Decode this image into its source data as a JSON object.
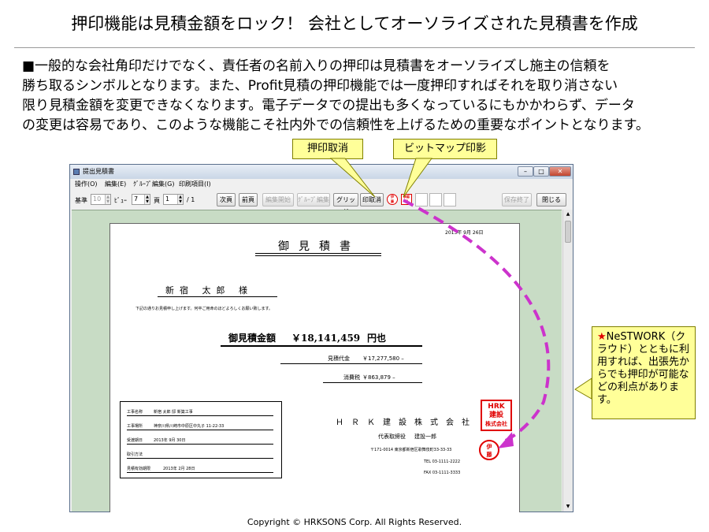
{
  "slide": {
    "title": "押印機能は見積金額をロック！ 会社としてオーソライズされた見積書を作成",
    "description": [
      "■一般的な会社角印だけでなく、責任者の名前入りの押印は見積書をオーソライズし施主の信頼を",
      "勝ち取るシンボルとなります。また、Profit見積の押印機能では一度押印すればそれを取り消さない",
      "限り見積金額を変更できなくなります。電子データでの提出も多くなっているにもかかわらず、データ",
      "の変更は容易であり、このような機能こそ社内外での信頼性を上げるための重要なポイントとなります。"
    ],
    "callouts": {
      "cancel": "押印取消",
      "bitmap": "ビットマップ印影",
      "cloud_star": "★",
      "cloud_brand": "NeSTWORK",
      "cloud_text": "（クラウド）とともに利用すれば、出張先からでも押印が可能などの利点があります。"
    },
    "footer": "Copyright ©  HRKSONS Corp.   All Rights Reserved."
  },
  "window": {
    "title": "提出見積書",
    "controls": {
      "minimize": "–",
      "maximize": "□",
      "close": "✕"
    },
    "menu": [
      "操作(O)",
      "編集(E)",
      "ｸﾞﾙｰﾌﾟ編集(G)",
      "印刷項目(I)"
    ],
    "toolbar": {
      "base_label": "基準",
      "base_value": "10",
      "view_label": "ﾋﾞｭｰ",
      "view_value": "7",
      "page_label": "頁",
      "page_value": "1",
      "page_total": "/ 1",
      "next_page": "次頁",
      "prev_page": "前頁",
      "edit_start": "編集開始",
      "group_edit": "ｸﾞﾙｰﾌﾟ編集",
      "grid": "グリッド",
      "cancel_stamp": "印取消",
      "save_exit": "保存終了",
      "close": "閉じる",
      "seal1_line1": "伊",
      "seal1_line2": "藤",
      "seal2_line1": "承認",
      "seal2_line2": "印"
    },
    "scroll": {
      "up": "▲",
      "down": "▼"
    }
  },
  "document": {
    "date": "2013年 9月 26日",
    "title": "御見積書",
    "customer": "新宿 太郎   様",
    "greeting": "下記の通りお見積申し上げます。何卒ご用命のほどよろしくお願い致します。",
    "total_label": "御見積金額",
    "total_value": "￥18,141,459",
    "total_unit": "円也",
    "subtotal_label": "見積代金",
    "subtotal_value": "￥17,277,580  –",
    "tax_label": "消費税",
    "tax_value": "￥863,879  –",
    "info": [
      {
        "label": "工事名称",
        "value": "新宿 太郎 邸 新築工事"
      },
      {
        "label": "工事場所",
        "value": "神奈川県川崎市中原区中丸子 11-22-33"
      },
      {
        "label": "受渡期日",
        "value": "2013年 9月 30日"
      },
      {
        "label": "取引方法",
        "value": ""
      },
      {
        "label": "見積有効期限",
        "value": "2013年 2月 28日"
      }
    ],
    "company": "ＨＲＫ建設株式会社",
    "rep_title": "代表取締役",
    "rep_name": "建設一郎",
    "address": "〒171-0014 東京都新宿区歌舞伎町33-33-33",
    "tel": "TEL  03-1111-2222",
    "fax": "FAX  03-1111-3333",
    "corp_seal": [
      "HRK",
      "建設",
      "株式会社"
    ],
    "personal_seal": [
      "伊",
      "藤"
    ]
  },
  "colors": {
    "callout_bg": "#ffff99",
    "canvas_bg": "#c8dcc5",
    "seal_red": "#e00000",
    "arrow_purple": "#cc33cc"
  }
}
